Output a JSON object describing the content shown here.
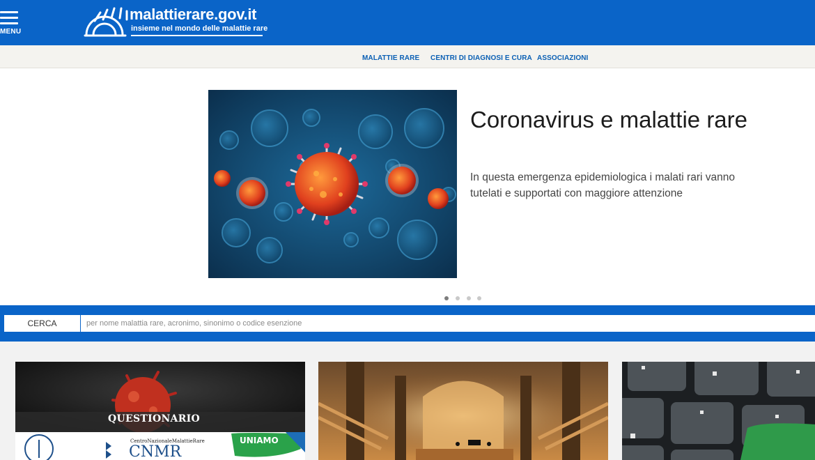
{
  "header": {
    "menu_label": "MENU",
    "site_name": "malattierare.gov.it",
    "tagline": "insieme nel mondo delle malattie rare",
    "colors": {
      "brand_blue": "#0a64c8",
      "subnav_bg": "#f4f3ef",
      "link_blue": "#0a5fb4"
    }
  },
  "subnav": {
    "items": [
      {
        "label": "MALATTIE RARE"
      },
      {
        "label": "CENTRI DI DIAGNOSI E CURA"
      },
      {
        "label": "ASSOCIAZIONI"
      }
    ]
  },
  "hero": {
    "title": "Coronavirus e malattie rare",
    "text": "In questa emergenza epidemiologica i malati rari vanno tutelati e supportati con maggiore attenzione",
    "image_icon": "coronavirus-illustration",
    "slides_total": 4,
    "active_slide": 1
  },
  "search": {
    "button_label": "CERCA",
    "placeholder": "per nome malattia rare, acronimo, sinonimo o codice esenzione",
    "value": ""
  },
  "cards": [
    {
      "banner_text": "QUESTIONARIO",
      "logo_cnmr_small": "CentroNazionaleMalattieRare",
      "logo_cnmr": "CNMR",
      "logo_uniamo": "UNIAMO",
      "image_icon": "coronavirus-questionnaire-image"
    },
    {
      "image_icon": "concert-hall-image"
    },
    {
      "image_icon": "keyboard-image"
    }
  ]
}
